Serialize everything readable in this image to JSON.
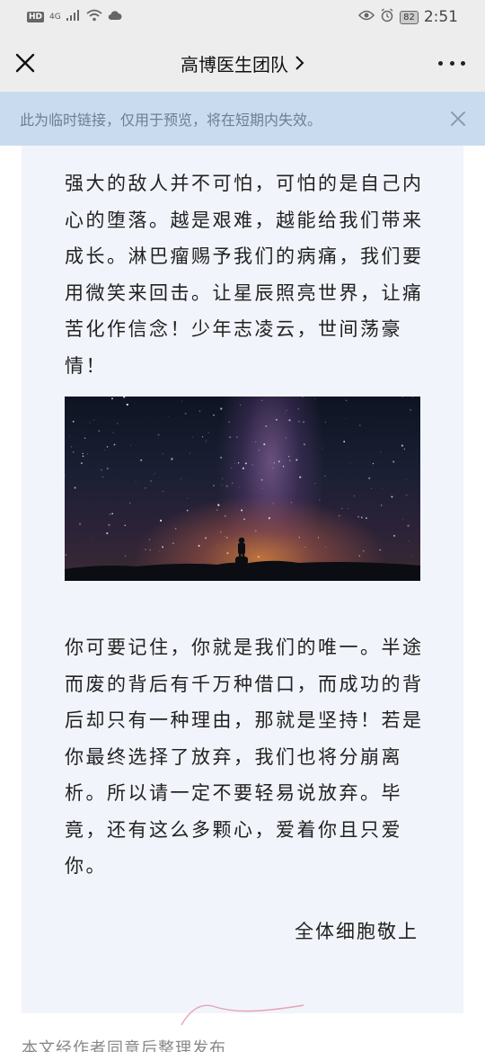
{
  "status_bar": {
    "hd_badge": "HD",
    "network": "4G",
    "battery": "82",
    "time": "2:51"
  },
  "header": {
    "title": "高博医生团队",
    "chevron": "chevron-right-icon"
  },
  "notice": {
    "text": "此为临时链接，仅用于预览，将在短期内失效。"
  },
  "article": {
    "paragraph1": "强大的敌人并不可怕，可怕的是自己内心的堕落。越是艰难，越能给我们带来成长。淋巴瘤赐予我们的病痛，我们要用微笑来回击。让星辰照亮世界，让痛苦化作信念！少年志凌云，世间荡豪情！",
    "paragraph2": "你可要记住，你就是我们的唯一。半途而废的背后有千万种借口，而成功的背后却只有一种理由，那就是坚持！若是你最终选择了放弃，我们也将分崩离析。所以请一定不要轻易说放弃。毕竟，还有这么多颗心，爱着你且只爱你。",
    "signature": "全体细胞敬上"
  },
  "footer": {
    "text": "本文经作者同意后整理发布"
  },
  "colors": {
    "header_bg": "#ededed",
    "notice_bg": "#c9dcef",
    "notice_text": "#6b7f94",
    "article_bg": "#f2f4fb"
  }
}
